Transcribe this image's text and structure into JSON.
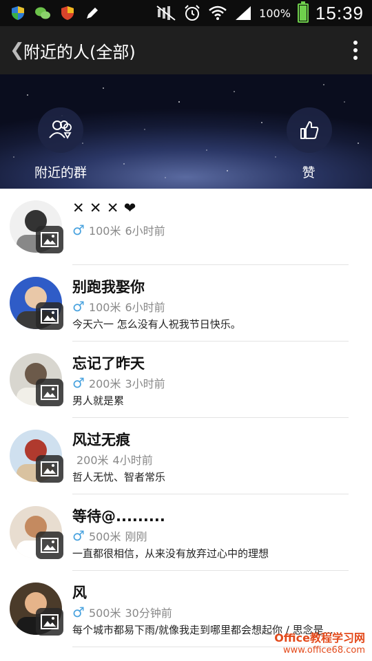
{
  "statusbar": {
    "battery_pct": "100%",
    "time": "15:39"
  },
  "appbar": {
    "title": "附近的人(全部)"
  },
  "banner": {
    "left_label": "附近的群",
    "right_label": "赞"
  },
  "people": [
    {
      "name": "✕ ✕ ✕ ❤",
      "gender": "♂",
      "distance": "100米",
      "time": "6小时前",
      "message": "",
      "avatar_colors": [
        "#f0f0f0",
        "#333333",
        "#888888"
      ]
    },
    {
      "name": "别跑我娶你",
      "gender": "♂",
      "distance": "100米",
      "time": "6小时前",
      "message": "今天六一  怎么没有人祝我节日快乐。",
      "avatar_colors": [
        "#2f5cc7",
        "#e9c8a8",
        "#3a3a3a"
      ]
    },
    {
      "name": "忘记了昨天",
      "gender": "♂",
      "distance": "200米",
      "time": "3小时前",
      "message": "男人就是累",
      "avatar_colors": [
        "#d8d6cf",
        "#6c5a4a",
        "#f1efe8"
      ]
    },
    {
      "name": "风过无痕",
      "gender": "",
      "distance": "200米",
      "time": "4小时前",
      "message": "哲人无忧、智者常乐",
      "avatar_colors": [
        "#cfe0ef",
        "#b03a2e",
        "#d9c2a0"
      ]
    },
    {
      "name": "等待@.........",
      "gender": "♂",
      "distance": "500米",
      "time": "刚刚",
      "message": "一直都很相信，从来没有放弃过心中的理想",
      "avatar_colors": [
        "#e8ddd0",
        "#c48a60",
        "#ffffff"
      ]
    },
    {
      "name": "风",
      "gender": "♂",
      "distance": "500米",
      "time": "30分钟前",
      "message": "每个城市都易下雨/就像我走到哪里都会想起你 / 思念是...",
      "avatar_colors": [
        "#4b3b2a",
        "#e6b48a",
        "#1a1a1a"
      ]
    }
  ],
  "watermark": {
    "line1": "Office教程学习网",
    "line2": "www.office68.com"
  }
}
